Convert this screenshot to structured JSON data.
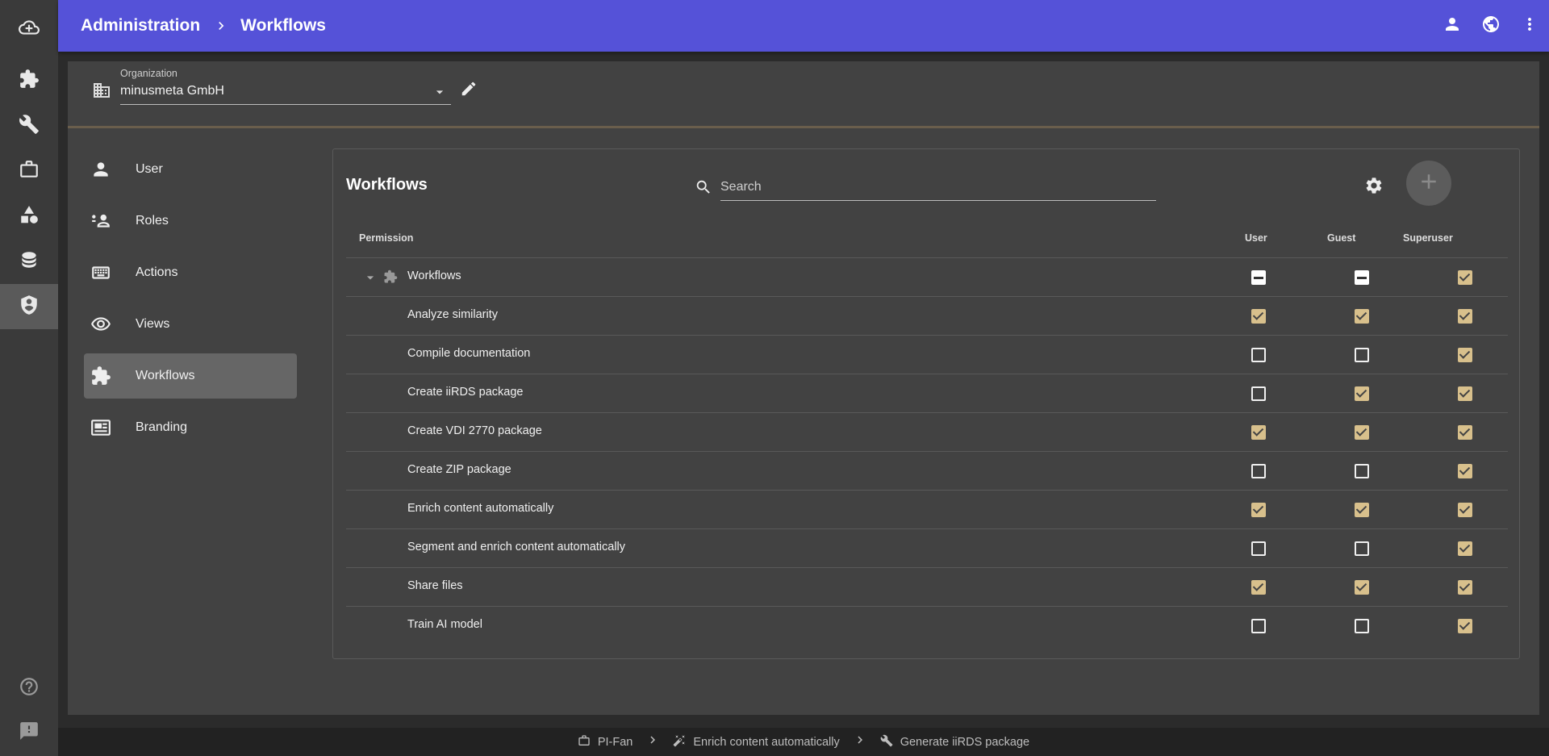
{
  "rail": {
    "items": [
      {
        "icon": "cloud-add-icon"
      },
      {
        "icon": "puzzle-icon"
      },
      {
        "icon": "wrench-icon"
      },
      {
        "icon": "briefcase-icon"
      },
      {
        "icon": "shapes-icon"
      },
      {
        "icon": "database-icon"
      },
      {
        "icon": "admin-shield-icon",
        "active": true
      },
      {
        "icon": "help-icon"
      },
      {
        "icon": "feedback-icon"
      }
    ]
  },
  "header": {
    "breadcrumb": [
      "Administration",
      "Workflows"
    ],
    "actions": [
      "account-icon",
      "language-globe-icon",
      "more-vert-icon"
    ],
    "color": "#5552d8"
  },
  "organization": {
    "label": "Organization",
    "value": "minusmeta GmbH"
  },
  "nav": {
    "items": [
      {
        "label": "User",
        "icon": "person-icon"
      },
      {
        "label": "Roles",
        "icon": "roles-icon"
      },
      {
        "label": "Actions",
        "icon": "keyboard-icon"
      },
      {
        "label": "Views",
        "icon": "eye-icon"
      },
      {
        "label": "Workflows",
        "icon": "puzzle-icon",
        "active": true
      },
      {
        "label": "Branding",
        "icon": "branding-icon"
      }
    ]
  },
  "panel": {
    "title": "Workflows",
    "search_placeholder": "Search"
  },
  "table": {
    "columns": [
      "Permission",
      "User",
      "Guest",
      "Superuser"
    ],
    "group": {
      "label": "Workflows",
      "user": "indeterminate",
      "guest": "indeterminate",
      "superuser": "checked"
    },
    "rows": [
      {
        "label": "Analyze similarity",
        "user": true,
        "guest": true,
        "superuser": true
      },
      {
        "label": "Compile documentation",
        "user": false,
        "guest": false,
        "superuser": true
      },
      {
        "label": "Create iiRDS package",
        "user": false,
        "guest": true,
        "superuser": true
      },
      {
        "label": "Create VDI 2770 package",
        "user": true,
        "guest": true,
        "superuser": true
      },
      {
        "label": "Create ZIP package",
        "user": false,
        "guest": false,
        "superuser": true
      },
      {
        "label": "Enrich content automatically",
        "user": true,
        "guest": true,
        "superuser": true
      },
      {
        "label": "Segment and enrich content automatically",
        "user": false,
        "guest": false,
        "superuser": true
      },
      {
        "label": "Share files",
        "user": true,
        "guest": true,
        "superuser": true
      },
      {
        "label": "Train AI model",
        "user": false,
        "guest": false,
        "superuser": true
      }
    ],
    "checked_color": "#d8c08c"
  },
  "footer": {
    "crumbs": [
      {
        "label": "PI-Fan",
        "icon": "briefcase-icon"
      },
      {
        "label": "Enrich content automatically",
        "icon": "magic-wand-icon"
      },
      {
        "label": "Generate iiRDS package",
        "icon": "wrench-icon"
      }
    ]
  }
}
